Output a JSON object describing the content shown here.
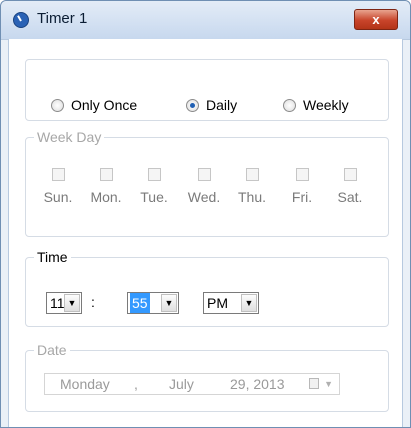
{
  "window": {
    "title": "Timer 1",
    "close_glyph": "x"
  },
  "frequency": {
    "options": [
      {
        "label": "Only Once",
        "checked": false
      },
      {
        "label": "Daily",
        "checked": true
      },
      {
        "label": "Weekly",
        "checked": false
      }
    ]
  },
  "weekday": {
    "legend": "Week Day",
    "days": [
      "Sun.",
      "Mon.",
      "Tue.",
      "Wed.",
      "Thu.",
      "Fri.",
      "Sat."
    ]
  },
  "time": {
    "legend": "Time",
    "hour": "11",
    "separator": ":",
    "minute": "55",
    "ampm": "PM",
    "arrow_glyph": "▼"
  },
  "date": {
    "legend": "Date",
    "weekday": "Monday",
    "comma": ",",
    "month": "July",
    "day_year": "29, 2013",
    "arrow_glyph": "▼"
  },
  "colors": {
    "accent": "#3399ff",
    "close_button": "#c8442a",
    "radio_dot": "#1f5fb3"
  }
}
